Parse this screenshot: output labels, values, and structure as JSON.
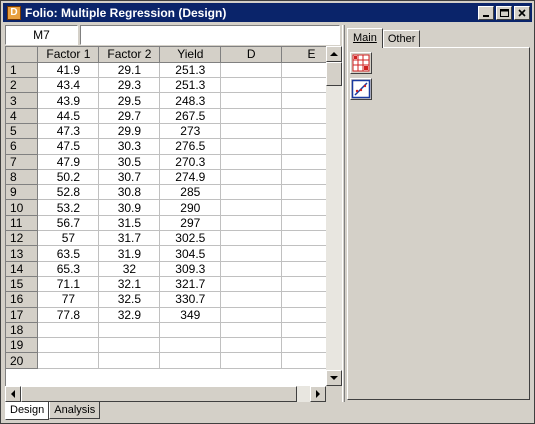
{
  "window": {
    "title": "Folio: Multiple Regression (Design)",
    "icon_letter": "D",
    "buttons": [
      "minimize-icon",
      "maximize-icon",
      "close-icon"
    ]
  },
  "refbar": {
    "cell_ref": "M7",
    "formula": ""
  },
  "grid": {
    "columns": [
      "Factor 1",
      "Factor 2",
      "Yield",
      "D",
      "E"
    ],
    "rows": [
      {
        "n": "1",
        "cells": [
          "41.9",
          "29.1",
          "251.3",
          "",
          ""
        ]
      },
      {
        "n": "2",
        "cells": [
          "43.4",
          "29.3",
          "251.3",
          "",
          ""
        ]
      },
      {
        "n": "3",
        "cells": [
          "43.9",
          "29.5",
          "248.3",
          "",
          ""
        ]
      },
      {
        "n": "4",
        "cells": [
          "44.5",
          "29.7",
          "267.5",
          "",
          ""
        ]
      },
      {
        "n": "5",
        "cells": [
          "47.3",
          "29.9",
          "273",
          "",
          ""
        ]
      },
      {
        "n": "6",
        "cells": [
          "47.5",
          "30.3",
          "276.5",
          "",
          ""
        ]
      },
      {
        "n": "7",
        "cells": [
          "47.9",
          "30.5",
          "270.3",
          "",
          ""
        ]
      },
      {
        "n": "8",
        "cells": [
          "50.2",
          "30.7",
          "274.9",
          "",
          ""
        ]
      },
      {
        "n": "9",
        "cells": [
          "52.8",
          "30.8",
          "285",
          "",
          ""
        ]
      },
      {
        "n": "10",
        "cells": [
          "53.2",
          "30.9",
          "290",
          "",
          ""
        ]
      },
      {
        "n": "11",
        "cells": [
          "56.7",
          "31.5",
          "297",
          "",
          ""
        ]
      },
      {
        "n": "12",
        "cells": [
          "57",
          "31.7",
          "302.5",
          "",
          ""
        ]
      },
      {
        "n": "13",
        "cells": [
          "63.5",
          "31.9",
          "304.5",
          "",
          ""
        ]
      },
      {
        "n": "14",
        "cells": [
          "65.3",
          "32",
          "309.3",
          "",
          ""
        ]
      },
      {
        "n": "15",
        "cells": [
          "71.1",
          "32.1",
          "321.7",
          "",
          ""
        ]
      },
      {
        "n": "16",
        "cells": [
          "77",
          "32.5",
          "330.7",
          "",
          ""
        ]
      },
      {
        "n": "17",
        "cells": [
          "77.8",
          "32.9",
          "349",
          "",
          ""
        ]
      },
      {
        "n": "18",
        "cells": [
          "",
          "",
          "",
          "",
          ""
        ]
      },
      {
        "n": "19",
        "cells": [
          "",
          "",
          "",
          "",
          ""
        ]
      },
      {
        "n": "20",
        "cells": [
          "",
          "",
          "",
          "",
          ""
        ]
      }
    ]
  },
  "panel": {
    "tabs": [
      {
        "label": "Main",
        "active": true
      },
      {
        "label": "Other",
        "active": false
      }
    ],
    "tools": [
      {
        "name": "design-table-icon"
      },
      {
        "name": "regression-plot-icon"
      }
    ]
  },
  "sheet_tabs": [
    {
      "label": "Design",
      "active": true
    },
    {
      "label": "Analysis",
      "active": false
    }
  ],
  "colors": {
    "titlebar": "#0a246a",
    "face": "#d4d0c8",
    "icon_red": "#d02020",
    "icon_blue": "#1a3aa0"
  }
}
